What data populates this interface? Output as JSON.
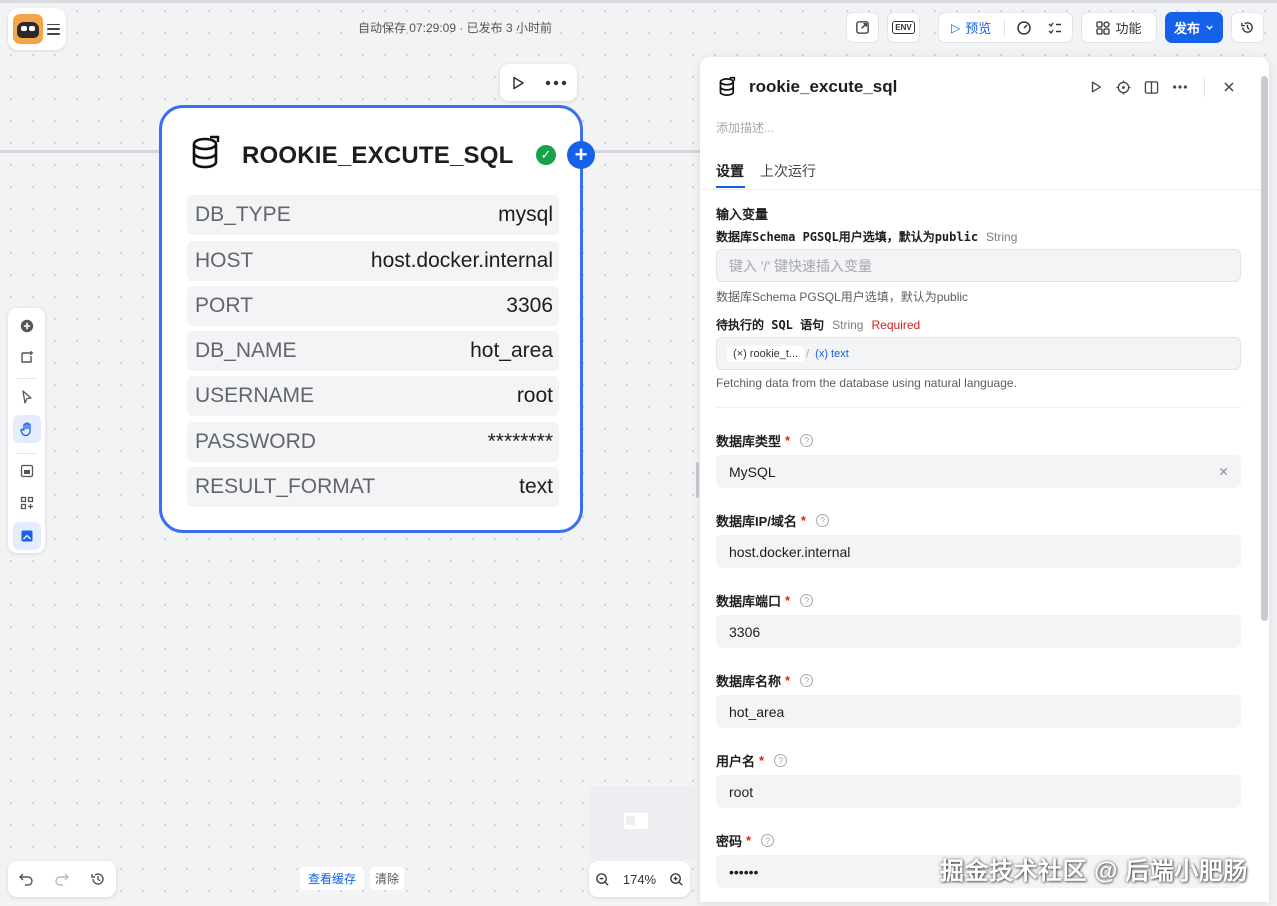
{
  "topbar": {
    "autosave": "自动保存 07:29:09 · 已发布 3 小时前",
    "preview_label": "预览",
    "features_label": "功能",
    "publish_label": "发布",
    "env_label": "ENV"
  },
  "node": {
    "title": "ROOKIE_EXCUTE_SQL",
    "rows": [
      {
        "key": "DB_TYPE",
        "value": "mysql"
      },
      {
        "key": "HOST",
        "value": "host.docker.internal"
      },
      {
        "key": "PORT",
        "value": "3306"
      },
      {
        "key": "DB_NAME",
        "value": "hot_area"
      },
      {
        "key": "USERNAME",
        "value": "root"
      },
      {
        "key": "PASSWORD",
        "value": "********"
      },
      {
        "key": "RESULT_FORMAT",
        "value": "text"
      }
    ]
  },
  "bottom": {
    "view_cache": "查看缓存",
    "clear": "清除",
    "zoom": "174%"
  },
  "panel": {
    "title": "rookie_excute_sql",
    "description_placeholder": "添加描述...",
    "tabs": [
      "设置",
      "上次运行"
    ],
    "input_vars_title": "输入变量",
    "schema": {
      "label": "数据库Schema PGSQL用户选填，默认为public",
      "type": "String",
      "placeholder": "键入 '/' 键快速插入变量",
      "help": "数据库Schema PGSQL用户选填，默认为public"
    },
    "sql": {
      "label": "待执行的 SQL 语句",
      "type": "String",
      "required": "Required",
      "tag1": "(×) rookie_t...",
      "sep": "/",
      "tag2": "(x) text",
      "help": "Fetching data from the database using natural language."
    },
    "fields": [
      {
        "label": "数据库类型",
        "value": "MySQL"
      },
      {
        "label": "数据库IP/域名",
        "value": "host.docker.internal"
      },
      {
        "label": "数据库端口",
        "value": "3306"
      },
      {
        "label": "数据库名称",
        "value": "hot_area"
      },
      {
        "label": "用户名",
        "value": "root"
      },
      {
        "label": "密码",
        "value": "••••••"
      }
    ],
    "required_star": "*",
    "help_icon": "?"
  },
  "watermark": "掘金技术社区 @ 后端小肥肠",
  "colors": {
    "accent": "#1661e9",
    "node_border": "#3a6ff0",
    "success": "#17a24a",
    "required": "#d5241e"
  }
}
